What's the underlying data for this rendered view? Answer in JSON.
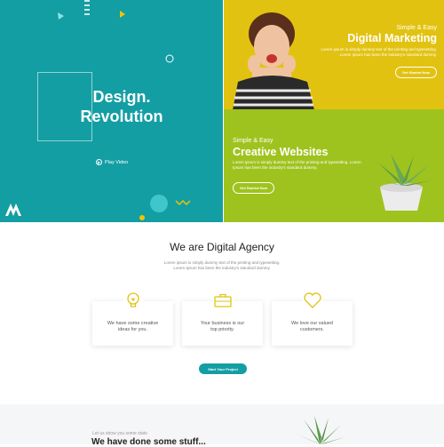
{
  "hero": {
    "left": {
      "title_line1": "Design.",
      "title_line2": "Revolution",
      "play_label": "Play Video",
      "logo": "M-logo-icon",
      "bg_color": "#139ea3"
    },
    "right_top": {
      "kicker": "Simple & Easy",
      "heading": "Digital Marketing",
      "body_line1": "Lorem ipsum is simply dummy text of the printing and typesetting.",
      "body_line2": "Lorem Ipsum has been the industry's standard dummy.",
      "button": "Get Started Now",
      "bg_color": "#e2c211"
    },
    "right_bottom": {
      "kicker": "Simple & Easy",
      "heading": "Creative Websites",
      "body_line1": "Lorem ipsum is simply dummy text of the printing and typesetting. Lorem",
      "body_line2": "Ipsum has been the industry's standard dummy.",
      "button": "Get Started Now",
      "bg_color": "#9fc31e"
    }
  },
  "agency": {
    "title": "We are Digital Agency",
    "sub_line1": "Lorem ipsum is simply dummy text of the printing and typesetting.",
    "sub_line2": "Lorem Ipsum has been the industry's standard dummy.",
    "cards": [
      {
        "icon": "lightbulb-icon",
        "line1": "We have some creative",
        "line2": "ideas for you."
      },
      {
        "icon": "briefcase-icon",
        "line1": "Your business is our",
        "line2": "top priority."
      },
      {
        "icon": "heart-icon",
        "line1": "We love our valued",
        "line2": "customers."
      }
    ],
    "cta": "Start Your Project",
    "accent": "#e2c211"
  },
  "stats": {
    "label": "Let us show you some stats",
    "title": "We have done some stuff..."
  }
}
